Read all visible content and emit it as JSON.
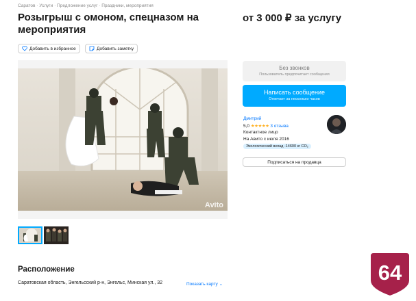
{
  "breadcrumbs": [
    "Саратов",
    "Услуги",
    "Предложение услуг",
    "Праздники, мероприятия"
  ],
  "breadcrumb_sep": "·",
  "listing": {
    "title": "Розыгрыш с омоном, спецназом на мероприятия",
    "price": "от 3 000 ₽ за услугу"
  },
  "actions": {
    "favorite_label": "Добавить в избранное",
    "note_label": "Добавить заметку"
  },
  "gallery": {
    "watermark": "Avito",
    "thumbnail_count": 2,
    "active_index": 0
  },
  "contact": {
    "no_calls_title": "Без звонков",
    "no_calls_sub": "Пользователь предпочитает сообщения",
    "message_title": "Написать сообщение",
    "message_sub": "Отвечает за несколько часов"
  },
  "seller": {
    "name": "Дмитрий",
    "rating": "5,0",
    "stars": "★★★★★",
    "reviews": "3 отзыва",
    "type": "Контактное лицо",
    "since": "На Авито с июля 2016",
    "eco": "Экологический вклад -14600 кг CO₂",
    "subscribe": "Подписаться на продавца"
  },
  "location": {
    "section_title": "Расположение",
    "address": "Саратовская область, Энгельсский р-н, Энгельс, Минская ул., 32",
    "map_link": "Показать карту"
  },
  "badge": {
    "text": "64",
    "color": "#a6214a"
  },
  "colors": {
    "accent": "#00aaff",
    "link": "#0077ff"
  }
}
